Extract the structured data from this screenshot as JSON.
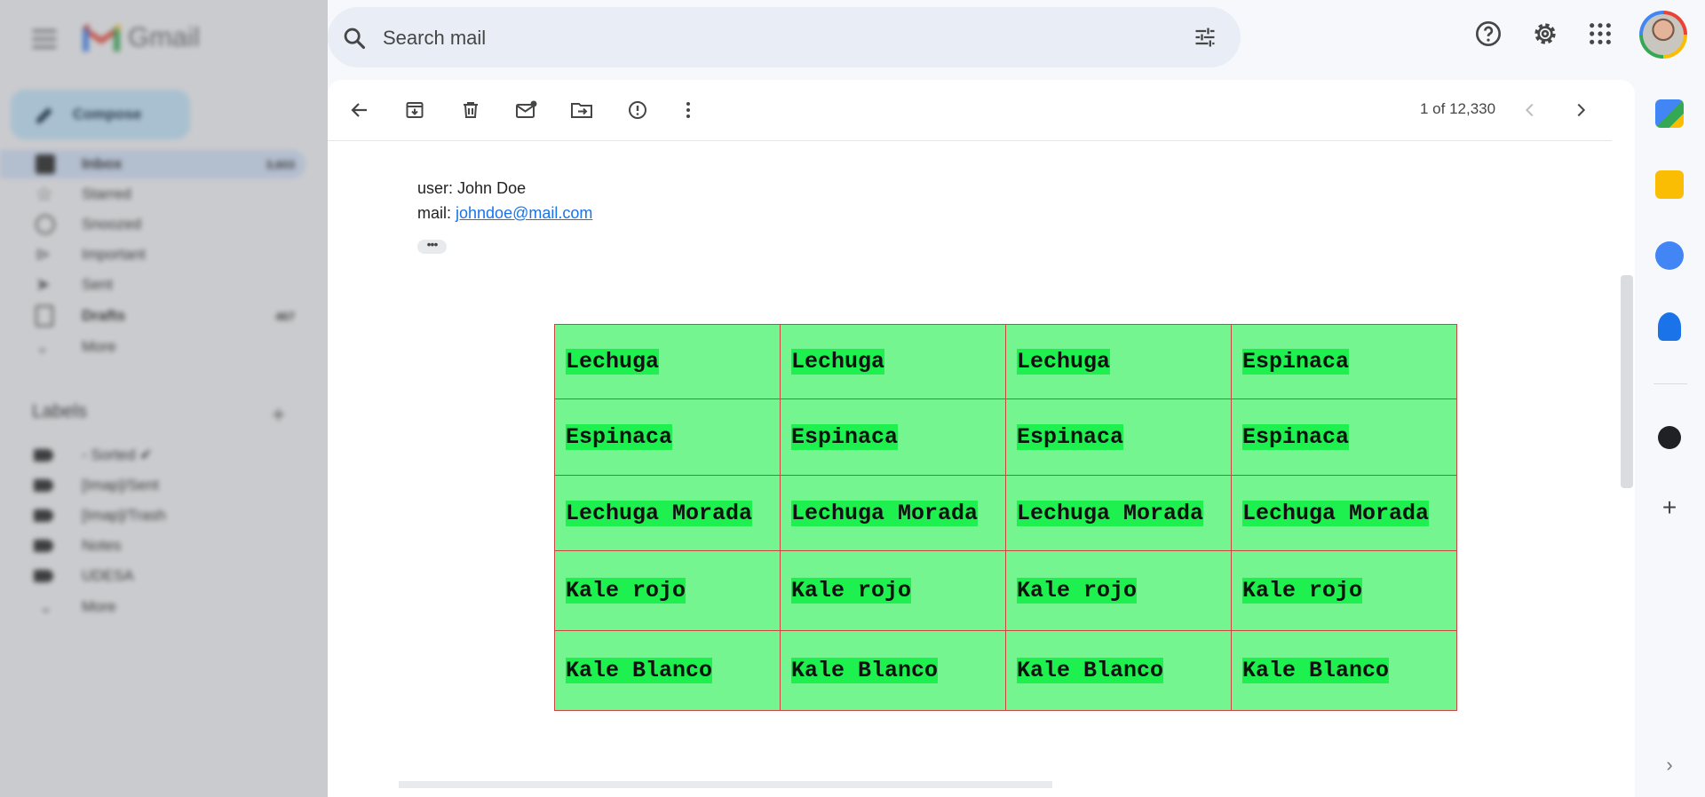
{
  "app": {
    "name": "Gmail",
    "compose_label": "Compose"
  },
  "sidebar": {
    "items": [
      {
        "label": "Inbox",
        "count": "3,603"
      },
      {
        "label": "Starred",
        "count": ""
      },
      {
        "label": "Snoozed",
        "count": ""
      },
      {
        "label": "Important",
        "count": ""
      },
      {
        "label": "Sent",
        "count": ""
      },
      {
        "label": "Drafts",
        "count": "467"
      },
      {
        "label": "More",
        "count": ""
      }
    ],
    "labels_heading": "Labels",
    "labels": [
      {
        "label": "- Sorted ✔"
      },
      {
        "label": "[Imap]/Sent"
      },
      {
        "label": "[Imap]/Trash"
      },
      {
        "label": "Notes"
      },
      {
        "label": "UDESA"
      },
      {
        "label": "More"
      }
    ]
  },
  "search": {
    "placeholder": "Search mail"
  },
  "toolbar": {
    "pager": "1 of 12,330"
  },
  "message": {
    "user_line_label": "user: ",
    "user_name": "John Doe",
    "mail_line_label": "mail: ",
    "mail_address": "johndoe@mail.com",
    "expand_label": "•••"
  },
  "table": {
    "rows": [
      [
        "Lechuga",
        "Lechuga",
        "Lechuga",
        "Espinaca"
      ],
      [
        "Espinaca",
        "Espinaca",
        "Espinaca",
        "Espinaca"
      ],
      [
        "Lechuga Morada",
        "Lechuga Morada",
        "Lechuga Morada",
        "Lechuga Morada"
      ],
      [
        "Kale rojo",
        "Kale rojo",
        "Kale rojo",
        "Kale rojo"
      ],
      [
        "Kale Blanco",
        "Kale Blanco",
        "Kale Blanco",
        "Kale Blanco"
      ]
    ]
  },
  "colors": {
    "cell_background": "#74f590",
    "cell_highlight": "#1df04f",
    "cell_border": "#cc4444",
    "link": "#1a73e8"
  }
}
